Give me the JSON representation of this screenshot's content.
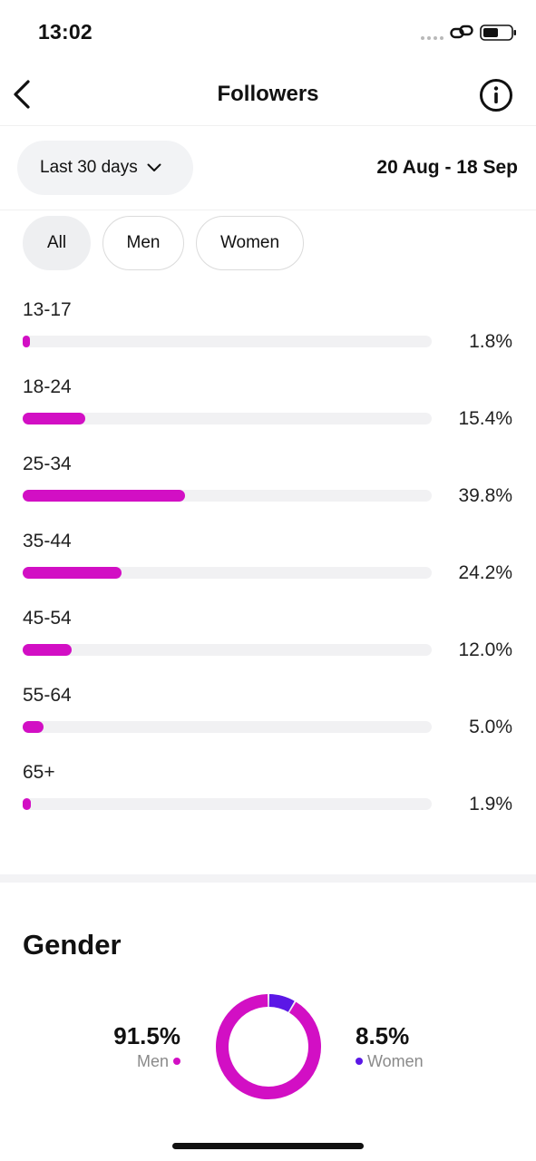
{
  "status_bar": {
    "time": "13:02"
  },
  "header": {
    "title": "Followers"
  },
  "filters": {
    "range_label": "Last 30 days",
    "dates": "20 Aug - 18 Sep"
  },
  "segments": [
    {
      "label": "All",
      "active": true
    },
    {
      "label": "Men",
      "active": false
    },
    {
      "label": "Women",
      "active": false
    }
  ],
  "colors": {
    "accent": "#d20fc4",
    "women": "#5b17e6",
    "track": "#f1f1f3"
  },
  "age_ranges": [
    {
      "label": "13-17",
      "value": "1.8%",
      "percent": 1.8
    },
    {
      "label": "18-24",
      "value": "15.4%",
      "percent": 15.4
    },
    {
      "label": "25-34",
      "value": "39.8%",
      "percent": 39.8
    },
    {
      "label": "35-44",
      "value": "24.2%",
      "percent": 24.2
    },
    {
      "label": "45-54",
      "value": "12.0%",
      "percent": 12.0
    },
    {
      "label": "55-64",
      "value": "5.0%",
      "percent": 5.0
    },
    {
      "label": "65+",
      "value": "1.9%",
      "percent": 1.9
    }
  ],
  "gender": {
    "heading": "Gender",
    "men": {
      "value": "91.5%",
      "label": "Men",
      "percent": 91.5
    },
    "women": {
      "value": "8.5%",
      "label": "Women",
      "percent": 8.5
    }
  }
}
